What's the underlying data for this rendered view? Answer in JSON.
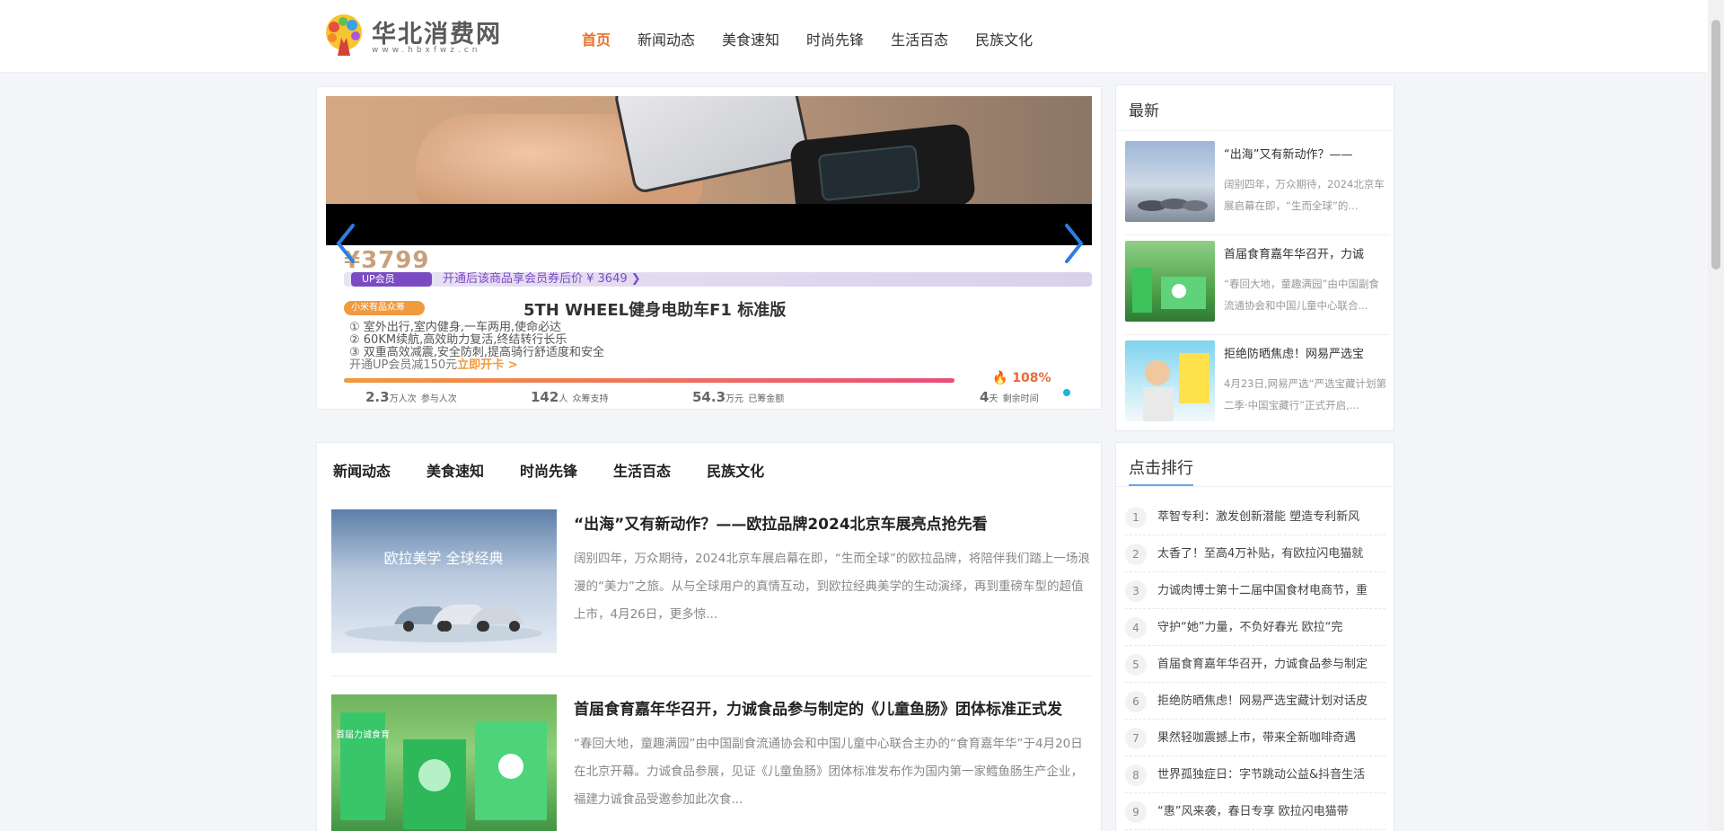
{
  "site": {
    "logo_text": "华北消费网",
    "logo_url": "www.hbxfwz.cn"
  },
  "nav": [
    {
      "label": "首页",
      "active": true
    },
    {
      "label": "新闻动态",
      "active": false
    },
    {
      "label": "美食速知",
      "active": false
    },
    {
      "label": "时尚先锋",
      "active": false
    },
    {
      "label": "生活百态",
      "active": false
    },
    {
      "label": "民族文化",
      "active": false
    }
  ],
  "slider": {
    "price": "¥3799",
    "promo_chip": "UP会员",
    "promo_text": "开通后该商品享会员券后价 ¥ 3649 ❯",
    "tag_chip": "小米有品众筹",
    "product_title": "5TH WHEEL健身电助车F1 标准版",
    "features": [
      "① 室外出行,室内健身,一车两用,使命必达",
      "② 60KM续航,高效助力复活,终结转行长乐",
      "③ 双重高效减震,安全防刺,提高骑行舒适度和安全"
    ],
    "open_vip_prefix": "开通UP会员减150元",
    "open_vip_link": "立即开卡 >",
    "progress_percent": 108,
    "progress_label": "108%",
    "stats": [
      {
        "value": "2.3",
        "unit": "万人次",
        "label": "参与人次"
      },
      {
        "value": "142",
        "unit": "人",
        "label": "众筹支持"
      },
      {
        "value": "54.3",
        "unit": "万元",
        "label": "已筹金额"
      },
      {
        "value": "4",
        "unit": "天",
        "label": "剩余时间"
      }
    ],
    "accent_color": "#1fb6d6"
  },
  "latest": {
    "title": "最新",
    "items": [
      {
        "title": "“出海”又有新动作？——",
        "desc": "阔别四年，万众期待，2024北京车展启幕在即，“生而全球”的..."
      },
      {
        "title": "首届食育嘉年华召开，力诚",
        "desc": "“春回大地，童趣满园”由中国副食流通协会和中国儿童中心联合..."
      },
      {
        "title": "拒绝防晒焦虑！网易严选宝",
        "desc": "4月23日,网易严选“严选宝藏计划第二季·中国宝藏行”正式开启,..."
      }
    ]
  },
  "rank": {
    "title": "点击排行",
    "items": [
      {
        "num": "1",
        "text": "萃智专利：激发创新潜能 塑造专利新风"
      },
      {
        "num": "2",
        "text": "太香了！至高4万补贴，有欧拉闪电猫就"
      },
      {
        "num": "3",
        "text": "力诚肉博士第十二届中国食材电商节，重"
      },
      {
        "num": "4",
        "text": "守护“她”力量，不负好春光 欧拉“完"
      },
      {
        "num": "5",
        "text": "首届食育嘉年华召开，力诚食品参与制定"
      },
      {
        "num": "6",
        "text": "拒绝防晒焦虑！网易严选宝藏计划对话皮"
      },
      {
        "num": "7",
        "text": "果然轻咖震撼上市，带来全新咖啡奇遇"
      },
      {
        "num": "8",
        "text": "世界孤独症日：字节跳动公益&抖音生活"
      },
      {
        "num": "9",
        "text": "“惠”风来袭，春日专享 欧拉闪电猫带"
      }
    ]
  },
  "news": {
    "tabs": [
      "新闻动态",
      "美食速知",
      "时尚先锋",
      "生活百态",
      "民族文化"
    ],
    "articles": [
      {
        "title": "“出海”又有新动作？——欧拉品牌2024北京车展亮点抢先看",
        "desc": "阔别四年，万众期待，2024北京车展启幕在即，“生而全球”的欧拉品牌，将陪伴我们踏上一场浪漫的“美力”之旅。从与全球用户的真情互动，到欧拉经典美学的生动演绎，再到重磅车型的超值上市，4月26日，更多惊...",
        "thumb_text": "欧拉美学 全球经典"
      },
      {
        "title": "首届食育嘉年华召开，力诚食品参与制定的《儿童鱼肠》团体标准正式发",
        "desc": "“春回大地，童趣满园”由中国副食流通协会和中国儿童中心联合主办的“食育嘉年华”于4月20日在北京开幕。力诚食品参展，见证《儿童鱼肠》团体标准发布作为国内第一家鳕鱼肠生产企业，福建力诚食品受邀参加此次食...",
        "thumb_text": "首届力诚食育"
      }
    ]
  }
}
